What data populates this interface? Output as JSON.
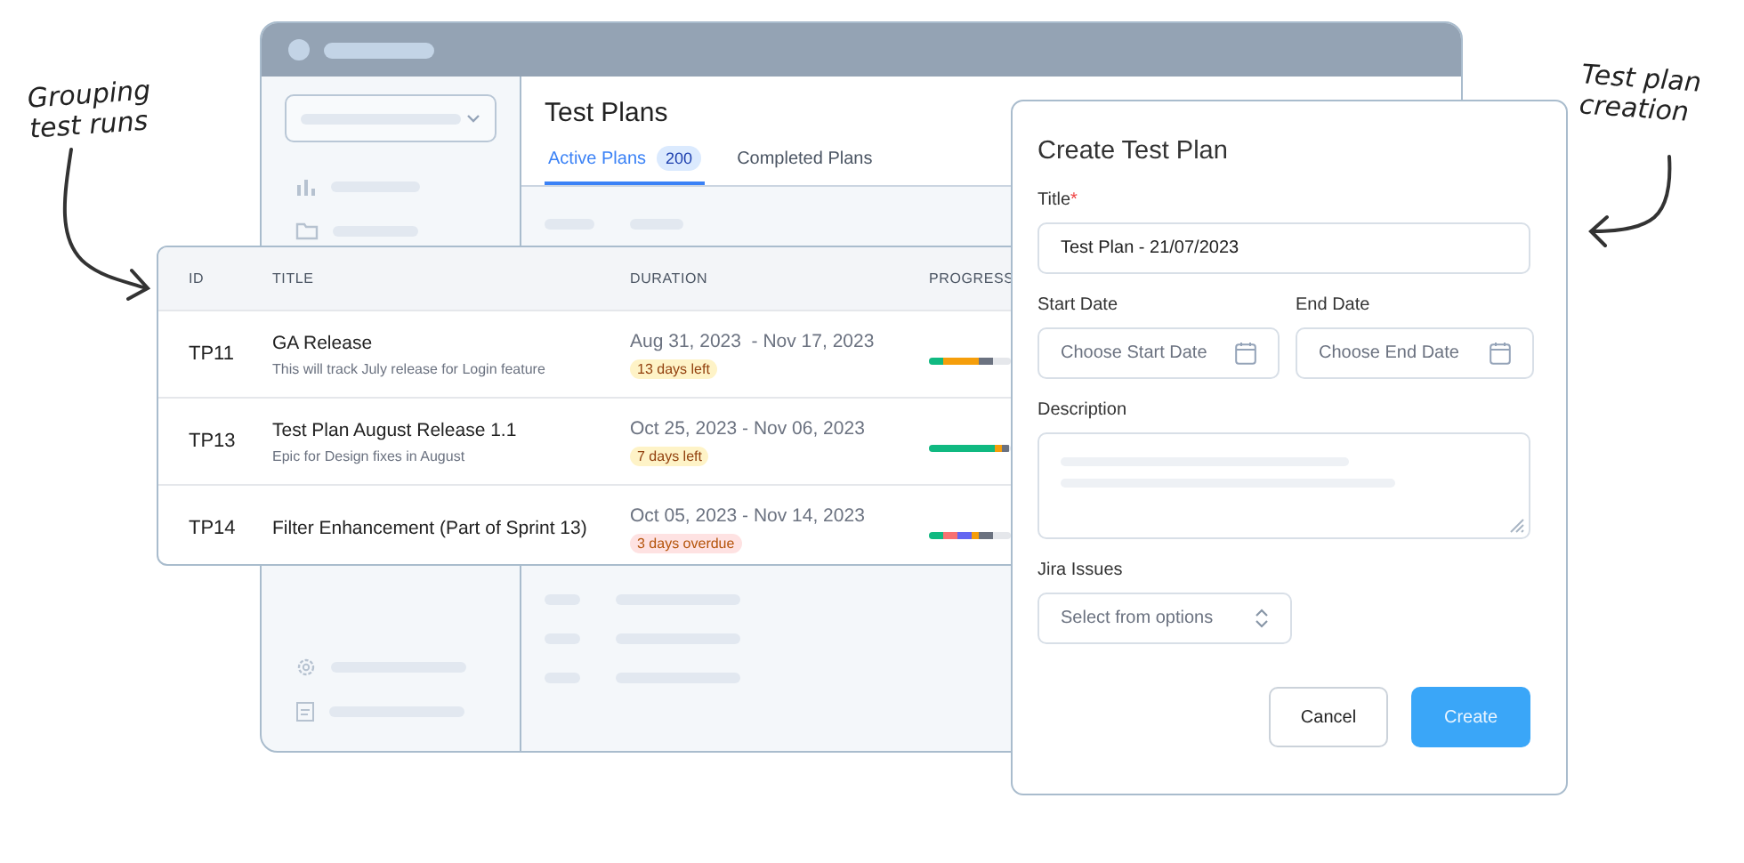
{
  "annotations": [
    {
      "kind": "left",
      "lines": [
        "Grouping",
        "test runs"
      ]
    },
    {
      "kind": "right",
      "lines": [
        "Test plan",
        "creation"
      ]
    }
  ],
  "app": {
    "title": "Test Plans",
    "tabs": [
      {
        "label": "Active Plans",
        "count": "200",
        "selected": true
      },
      {
        "label": "Completed Plans",
        "selected": false
      }
    ]
  },
  "table": {
    "columns": [
      "ID",
      "TITLE",
      "DURATION",
      "PROGRESS"
    ],
    "rows": [
      {
        "id": "TP11",
        "title": "GA Release",
        "subtitle": "This will track July release for Login feature",
        "duration": "Aug 31, 2023  - Nov 17, 2023",
        "status": "13 days left",
        "overdue": false,
        "progress": [
          {
            "color": "#10b981",
            "kind": "short"
          },
          {
            "color": "#f59e0b",
            "kind": "medium"
          },
          {
            "color": "#6b7280",
            "kind": "short"
          }
        ]
      },
      {
        "id": "TP13",
        "title": "Test Plan August Release 1.1",
        "subtitle": "Epic for Design fixes in August",
        "duration": "Oct 25, 2023 - Nov 06, 2023",
        "status": "7 days left",
        "overdue": false,
        "progress": [
          {
            "color": "#10b981",
            "kind": "long"
          },
          {
            "color": "#f59e0b",
            "kind": "tiny"
          },
          {
            "color": "#6b7280",
            "kind": "tiny"
          }
        ]
      },
      {
        "id": "TP14",
        "title": "Filter Enhancement (Part of Sprint 13)",
        "duration": "Oct 05, 2023 - Nov 14, 2023",
        "status": "3 days overdue",
        "overdue": true,
        "progress": [
          {
            "color": "#10b981",
            "kind": "short"
          },
          {
            "color": "#f87171",
            "kind": "short"
          },
          {
            "color": "#6366f1",
            "kind": "short"
          },
          {
            "color": "#f59e0b",
            "kind": "tiny"
          },
          {
            "color": "#6b7280",
            "kind": "short"
          }
        ]
      }
    ]
  },
  "dialog": {
    "title": "Create Test Plan",
    "fields": [
      {
        "kind": "text",
        "label": "Title",
        "required_mark": "*",
        "value": "Test Plan - 21/07/2023"
      },
      {
        "kind": "date",
        "label": "Start Date",
        "placeholder": "Choose Start Date"
      },
      {
        "kind": "date",
        "label": "End Date",
        "placeholder": "Choose End Date"
      },
      {
        "kind": "textarea",
        "label": "Description"
      },
      {
        "kind": "select",
        "label": "Jira Issues",
        "placeholder": "Select from options"
      }
    ],
    "buttons": [
      {
        "label": "Cancel",
        "kind": "secondary"
      },
      {
        "label": "Create",
        "kind": "primary"
      }
    ]
  }
}
